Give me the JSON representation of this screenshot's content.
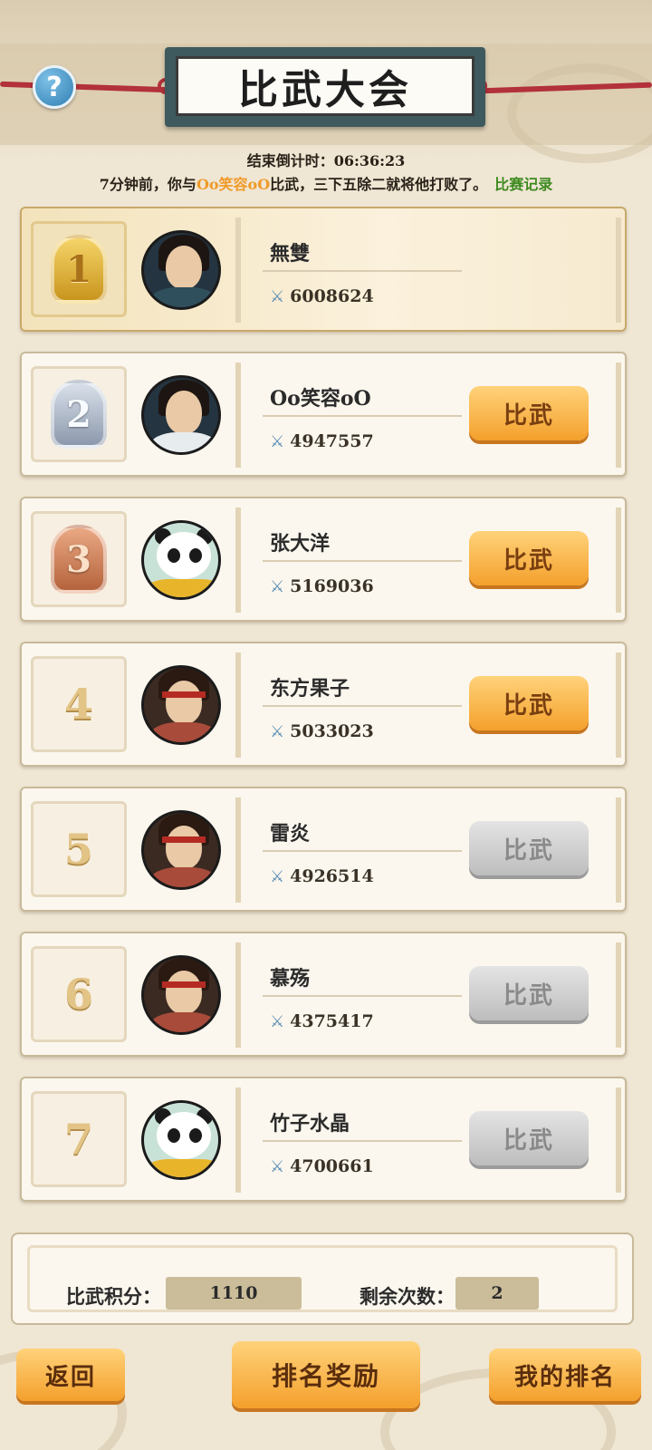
{
  "header": {
    "title": "比武大会",
    "help_label": "?",
    "countdown_label": "结束倒计时：",
    "countdown_value": "06:36:23",
    "notice_prefix": "7分钟前，你与",
    "notice_opponent": "Oo笑容oO",
    "notice_suffix": "比武，三下五除二就将他打败了。",
    "record_link": "比赛记录"
  },
  "ranking": [
    {
      "rank": "1",
      "name": "無雙",
      "power": "6008624",
      "badge": "gold",
      "avatar": "swordsman-icon",
      "button": null
    },
    {
      "rank": "2",
      "name": "Oo笑容oO",
      "power": "4947557",
      "badge": "silver",
      "avatar": "scholar-icon",
      "button": "比武",
      "button_state": "active"
    },
    {
      "rank": "3",
      "name": "张大洋",
      "power": "5169036",
      "badge": "bronze",
      "avatar": "panda-icon",
      "button": "比武",
      "button_state": "active"
    },
    {
      "rank": "4",
      "name": "东方果子",
      "power": "5033023",
      "badge": "none",
      "avatar": "warrior-icon",
      "button": "比武",
      "button_state": "active"
    },
    {
      "rank": "5",
      "name": "雷炎",
      "power": "4926514",
      "badge": "none",
      "avatar": "warrior-icon",
      "button": "比武",
      "button_state": "disabled"
    },
    {
      "rank": "6",
      "name": "慕殇",
      "power": "4375417",
      "badge": "none",
      "avatar": "warrior-icon",
      "button": "比武",
      "button_state": "disabled"
    },
    {
      "rank": "7",
      "name": "竹子水晶",
      "power": "4700661",
      "badge": "none",
      "avatar": "panda-icon",
      "button": "比武",
      "button_state": "disabled"
    }
  ],
  "stats": {
    "score_label": "比武积分：",
    "score_value": "1110",
    "remaining_label": "剩余次数：",
    "remaining_value": "2"
  },
  "buttons": {
    "back": "返回",
    "rank_reward": "排名奖励",
    "my_rank": "我的排名"
  },
  "colors": {
    "accent_orange": "#f4a02c",
    "opponent_name": "#f09a2a",
    "record_link": "#3d8a1f",
    "rope_red": "#b2313b",
    "title_plate": "#3e5a5e"
  }
}
